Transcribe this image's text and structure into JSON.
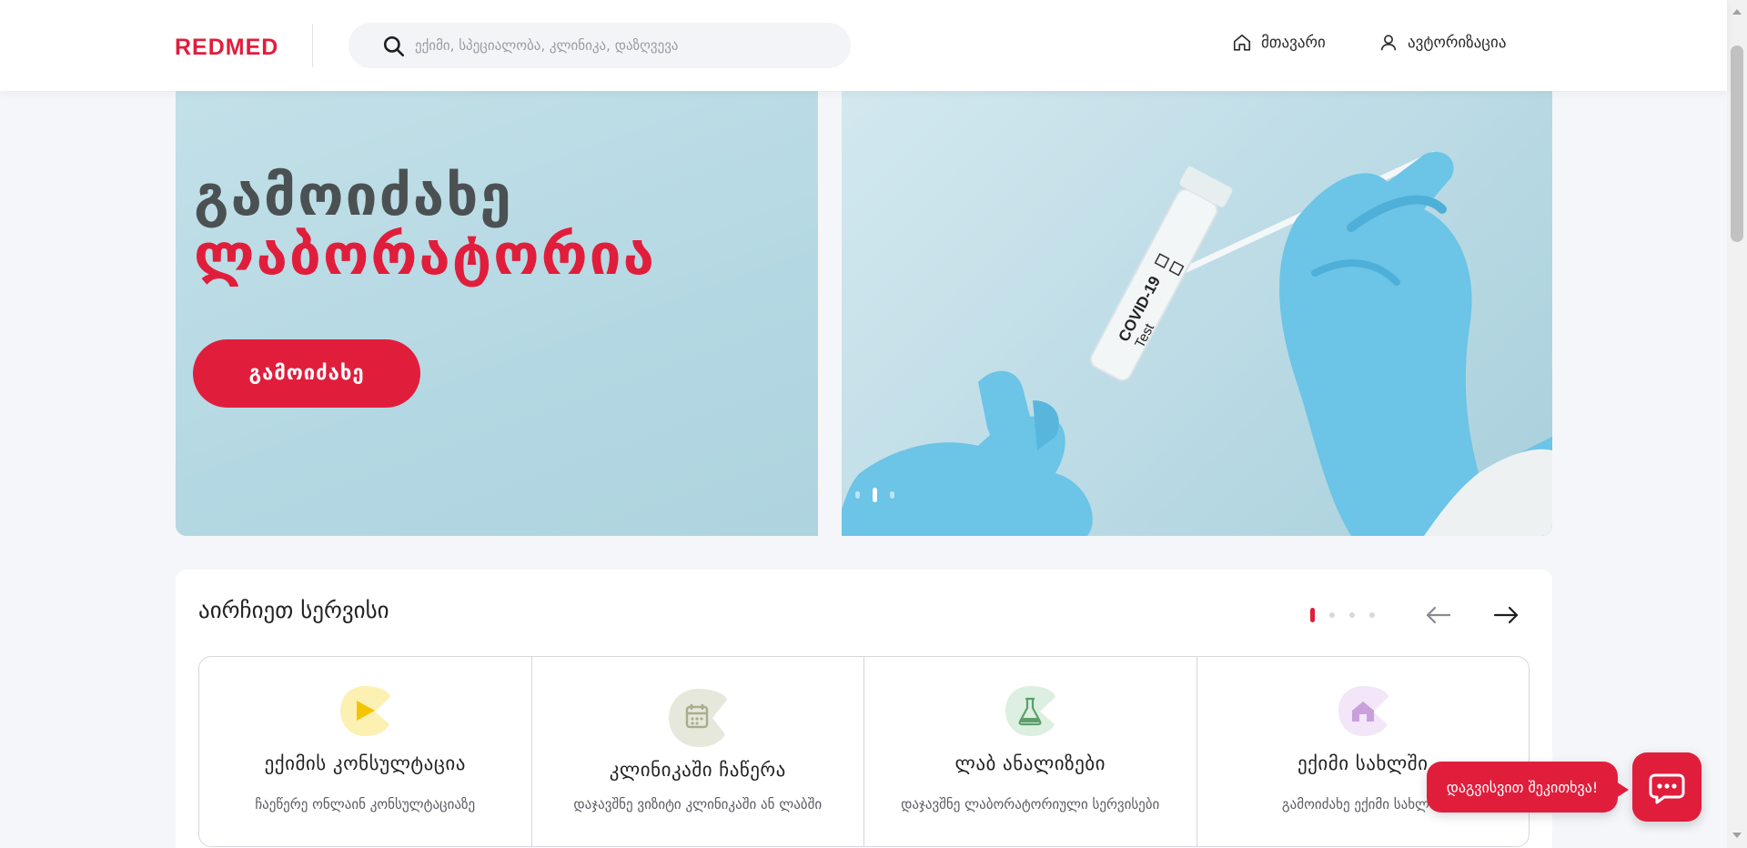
{
  "header": {
    "logo": "REDMED",
    "search_placeholder": "ექიმი, სპეციალობა, კლინიკა, დაზღვევა",
    "nav": {
      "home_label": "მთავარი",
      "login_label": "ავტორიზაცია"
    }
  },
  "hero": {
    "title_line1": "გამოიძახე",
    "title_line2": "ლაბორატორია",
    "button_label": "გამოიძახე",
    "image_alt": "COVID-19 Test",
    "slides": 3,
    "active_slide": 2
  },
  "services": {
    "title": "აირჩიეთ სერვისი",
    "pages": 4,
    "active_page": 1,
    "cards": [
      {
        "name": "ექიმის კონსულტაცია",
        "desc": "ჩაეწერე ონლაინ კონსულტაციაზე",
        "icon": "play-icon",
        "color": "#f5c400"
      },
      {
        "name": "კლინიკაში ჩაწერა",
        "desc": "დაჯავშნე ვიზიტი კლინიკაში ან ლაბში",
        "icon": "calendar-icon",
        "color": "#a9ad8e"
      },
      {
        "name": "ლაბ ანალიზები",
        "desc": "დაჯავშნე ლაბორატორიული სერვისები",
        "icon": "flask-icon",
        "color": "#5aa06a"
      },
      {
        "name": "ექიმი სახლში",
        "desc": "გამოიძახე ექიმი სახლში",
        "icon": "house-icon",
        "color": "#c9a0dc"
      }
    ]
  },
  "chat": {
    "bubble_text": "დაგვისვით შეკითხვა!"
  },
  "colors": {
    "brand": "#e01e3c",
    "hero_bg": "#b9dbe5"
  }
}
